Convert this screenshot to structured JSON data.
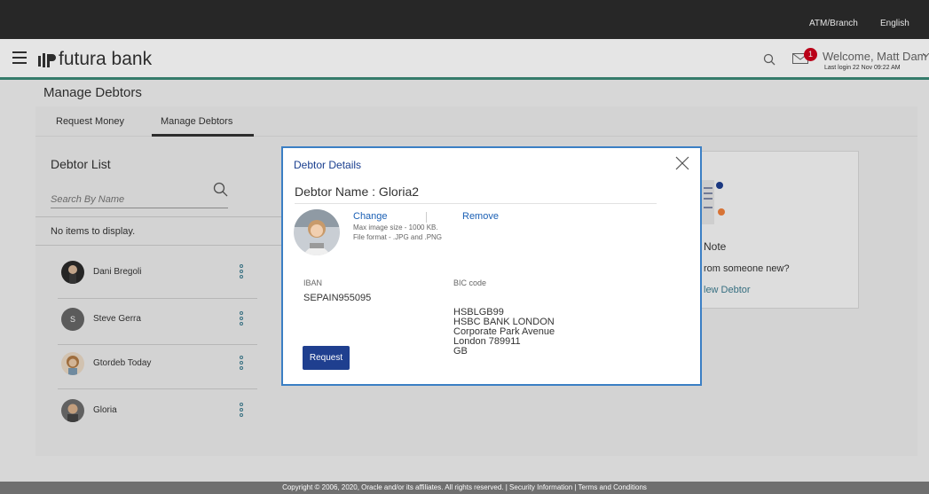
{
  "topbar": {
    "atm_branch": "ATM/Branch",
    "language": "English"
  },
  "header": {
    "logo_text": "futura bank",
    "mail_badge": "1",
    "welcome": "Welcome, Matt Dam",
    "last_login": "Last login 22 Nov 09:22 AM"
  },
  "page": {
    "title": "Manage Debtors",
    "tabs": [
      {
        "label": "Request Money"
      },
      {
        "label": "Manage Debtors"
      }
    ]
  },
  "debtor_list": {
    "title": "Debtor List",
    "search_placeholder": "Search By Name",
    "empty_message": "No items to display.",
    "items": [
      {
        "name": "Dani Bregoli"
      },
      {
        "name": "Steve Gerra",
        "initial": "S"
      },
      {
        "name": "Gtordeb Today"
      },
      {
        "name": "Gloria"
      }
    ]
  },
  "background_card": {
    "note": "Note",
    "from_text": "rom someone new?",
    "new_debtor": "lew Debtor"
  },
  "modal": {
    "title": "Debtor Details",
    "debtor_name": "Debtor Name : Gloria2",
    "change": "Change",
    "remove": "Remove",
    "max_size": "Max image size - 1000 KB.",
    "file_format": "File format - .JPG and .PNG",
    "iban_label": "IBAN",
    "iban_value": "SEPAIN955095",
    "bic_label": "BIC code",
    "bic_lines": [
      "HSBLGB99",
      "HSBC BANK LONDON",
      "Corporate Park Avenue",
      "London 789911",
      "GB"
    ],
    "request_button": "Request"
  },
  "footer": {
    "text": "Copyright © 2006, 2020, Oracle and/or its affiliates. All rights reserved. | Security Information | Terms and Conditions"
  },
  "colors": {
    "accent": "#1f3f8f",
    "header_rule": "#3b8a78",
    "badge": "#d0021b",
    "modal_border": "#3b7fc4"
  }
}
